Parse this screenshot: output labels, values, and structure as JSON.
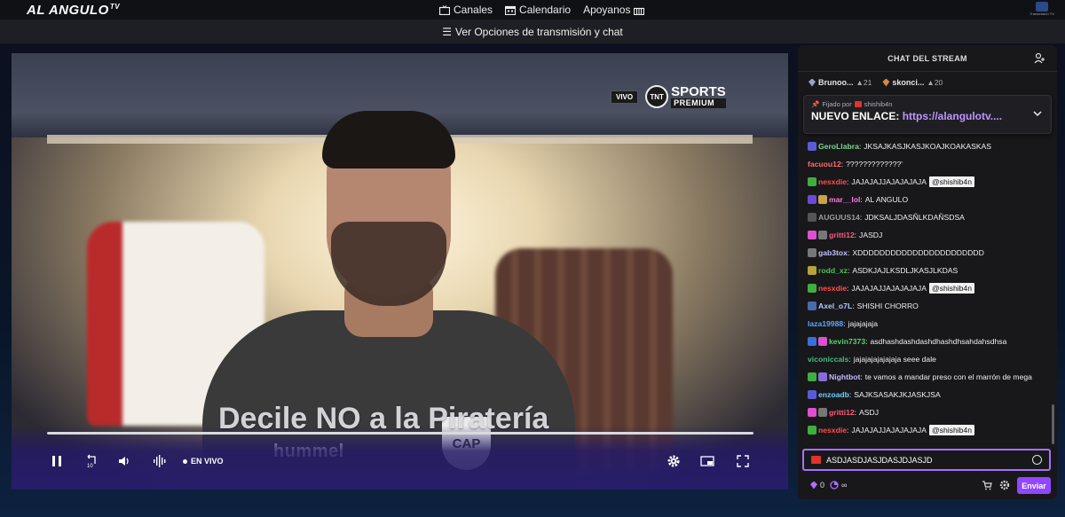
{
  "brand": {
    "logo_text": "AL ANGULO",
    "logo_suffix": "TV"
  },
  "nav": {
    "items": [
      {
        "label": "Canales",
        "icon": "tv-icon"
      },
      {
        "label": "Calendario",
        "icon": "calendar-icon"
      },
      {
        "label": "Apoyanos",
        "icon": "gift-icon"
      }
    ],
    "corner_logo_text": "Transmisión TV"
  },
  "options_bar": {
    "label": "Ver Opciones de transmisión y chat",
    "icon": "menu-icon"
  },
  "player": {
    "overlay_text": "Decile NO a la Piratería",
    "vivo_chip": "VIVO",
    "network_logo_circle": "TNT",
    "network_name": "SPORTS",
    "network_tier": "PREMIUM",
    "jersey_badge": "CAP",
    "jersey_brand": "hummel",
    "live_label": "EN VIVO",
    "progress_fraction": 1.0
  },
  "chat": {
    "title": "CHAT DEL STREAM",
    "leaders": [
      {
        "name": "Brunoo...",
        "points": "21",
        "gem_color": "#9aa3c6"
      },
      {
        "name": "skonci...",
        "points": "20",
        "gem_color": "#d98840"
      }
    ],
    "pinned": {
      "meta_prefix": "Fijado por",
      "meta_user": "shishib4n",
      "text": "NUEVO ENLACE: ",
      "link": "https://alangulotv...."
    },
    "messages": [
      {
        "badges": [
          "#5b5bd6"
        ],
        "user": "GeroLlabra",
        "color": "#7bd88f",
        "text": "JKSAJKASJKASJKOAJKOAKASKAS",
        "mention": ""
      },
      {
        "badges": [],
        "user": "facuou12",
        "color": "#ff6b6b",
        "text": "?????????????'",
        "mention": ""
      },
      {
        "badges": [
          "#3fae3f"
        ],
        "user": "nesxdie",
        "color": "#ff4f4f",
        "text": "JAJAJAJJAJAJAJAJA",
        "mention": "@shishib4n"
      },
      {
        "badges": [
          "#6a4ad8",
          "#c9a24a"
        ],
        "user": "mar__lol",
        "color": "#ff7ae0",
        "text": "AL ANGULO",
        "mention": ""
      },
      {
        "badges": [
          "#555"
        ],
        "user": "AUGUUS14",
        "color": "#9a9aa3",
        "text": "JDKSALJDASÑLKDAÑSDSA",
        "mention": ""
      },
      {
        "badges": [
          "#e04fd0",
          "#777"
        ],
        "user": "gritti12",
        "color": "#ff5a7a",
        "text": "JASDJ",
        "mention": ""
      },
      {
        "badges": [
          "#777"
        ],
        "user": "gab3tox",
        "color": "#c0c0ff",
        "text": "XDDDDDDDDDDDDDDDDDDDDDDD",
        "mention": ""
      },
      {
        "badges": [
          "#b8a23a"
        ],
        "user": "rodd_xz",
        "color": "#4fc14f",
        "text": "ASDKJAJLKSDLJKASJLKDAS",
        "mention": ""
      },
      {
        "badges": [
          "#3fae3f"
        ],
        "user": "nesxdie",
        "color": "#ff4f4f",
        "text": "JAJAJAJJAJAJAJAJA",
        "mention": "@shishib4n"
      },
      {
        "badges": [
          "#4a6ab0"
        ],
        "user": "Axel_o7L",
        "color": "#b4c8ff",
        "text": "SHISHI CHORRO",
        "mention": ""
      },
      {
        "badges": [],
        "user": "laza19988",
        "color": "#5aa5ff",
        "text": "jajajajaja",
        "mention": ""
      },
      {
        "badges": [
          "#3a6fd8",
          "#e04fd0"
        ],
        "user": "kevin7373",
        "color": "#5ad06a",
        "text": "asdhashdashdashdhashdhsahdahsdhsa",
        "mention": ""
      },
      {
        "badges": [],
        "user": "viconiccals",
        "color": "#3fbf7f",
        "text": "jajajajajajajaja seee dale",
        "mention": ""
      },
      {
        "badges": [
          "#3fae3f",
          "#8a6ad8"
        ],
        "user": "Nightbot",
        "color": "#c7b8ff",
        "text": "te vamos a mandar preso con el marrón de mega",
        "mention": ""
      },
      {
        "badges": [
          "#5b5bd6"
        ],
        "user": "enzoadb",
        "color": "#6ad0ff",
        "text": "SAJKSASAKJKJASKJSA",
        "mention": ""
      },
      {
        "badges": [
          "#e04fd0",
          "#777"
        ],
        "user": "gritti12",
        "color": "#ff5a7a",
        "text": "ASDJ",
        "mention": ""
      },
      {
        "badges": [
          "#3fae3f"
        ],
        "user": "nesxdie",
        "color": "#ff4f4f",
        "text": "JAJAJAJJAJAJAJAJA",
        "mention": "@shishib4n"
      }
    ],
    "input_value": "ASDJASDJASJDASJDJASJD",
    "footer": {
      "points": "0",
      "infinity": "∞",
      "send_label": "Enviar"
    }
  }
}
